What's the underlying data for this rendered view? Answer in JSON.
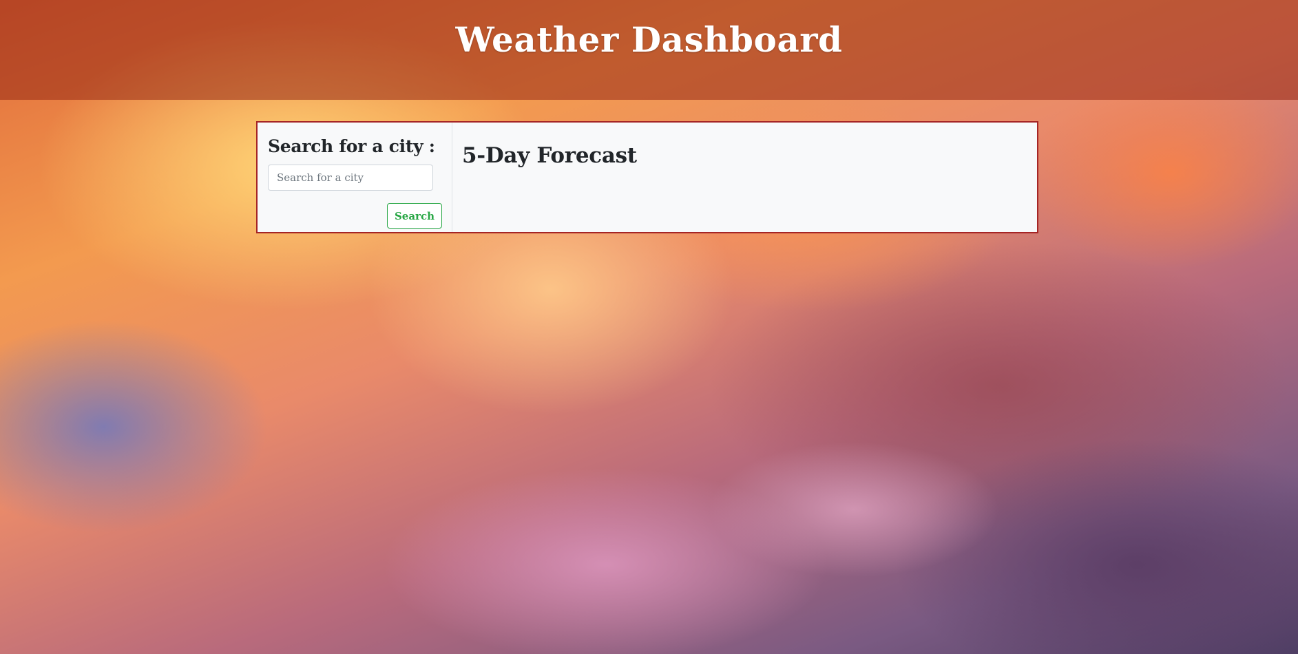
{
  "header": {
    "title": "Weather Dashboard"
  },
  "search": {
    "title": "Search for a city :",
    "placeholder": "Search for a city",
    "value": "",
    "button_label": "Search"
  },
  "forecast": {
    "title": "5-Day Forecast"
  },
  "colors": {
    "header_overlay": "#962814",
    "panel_border": "#a52525",
    "button_accent": "#28a745",
    "panel_background": "#f8f9fa"
  }
}
